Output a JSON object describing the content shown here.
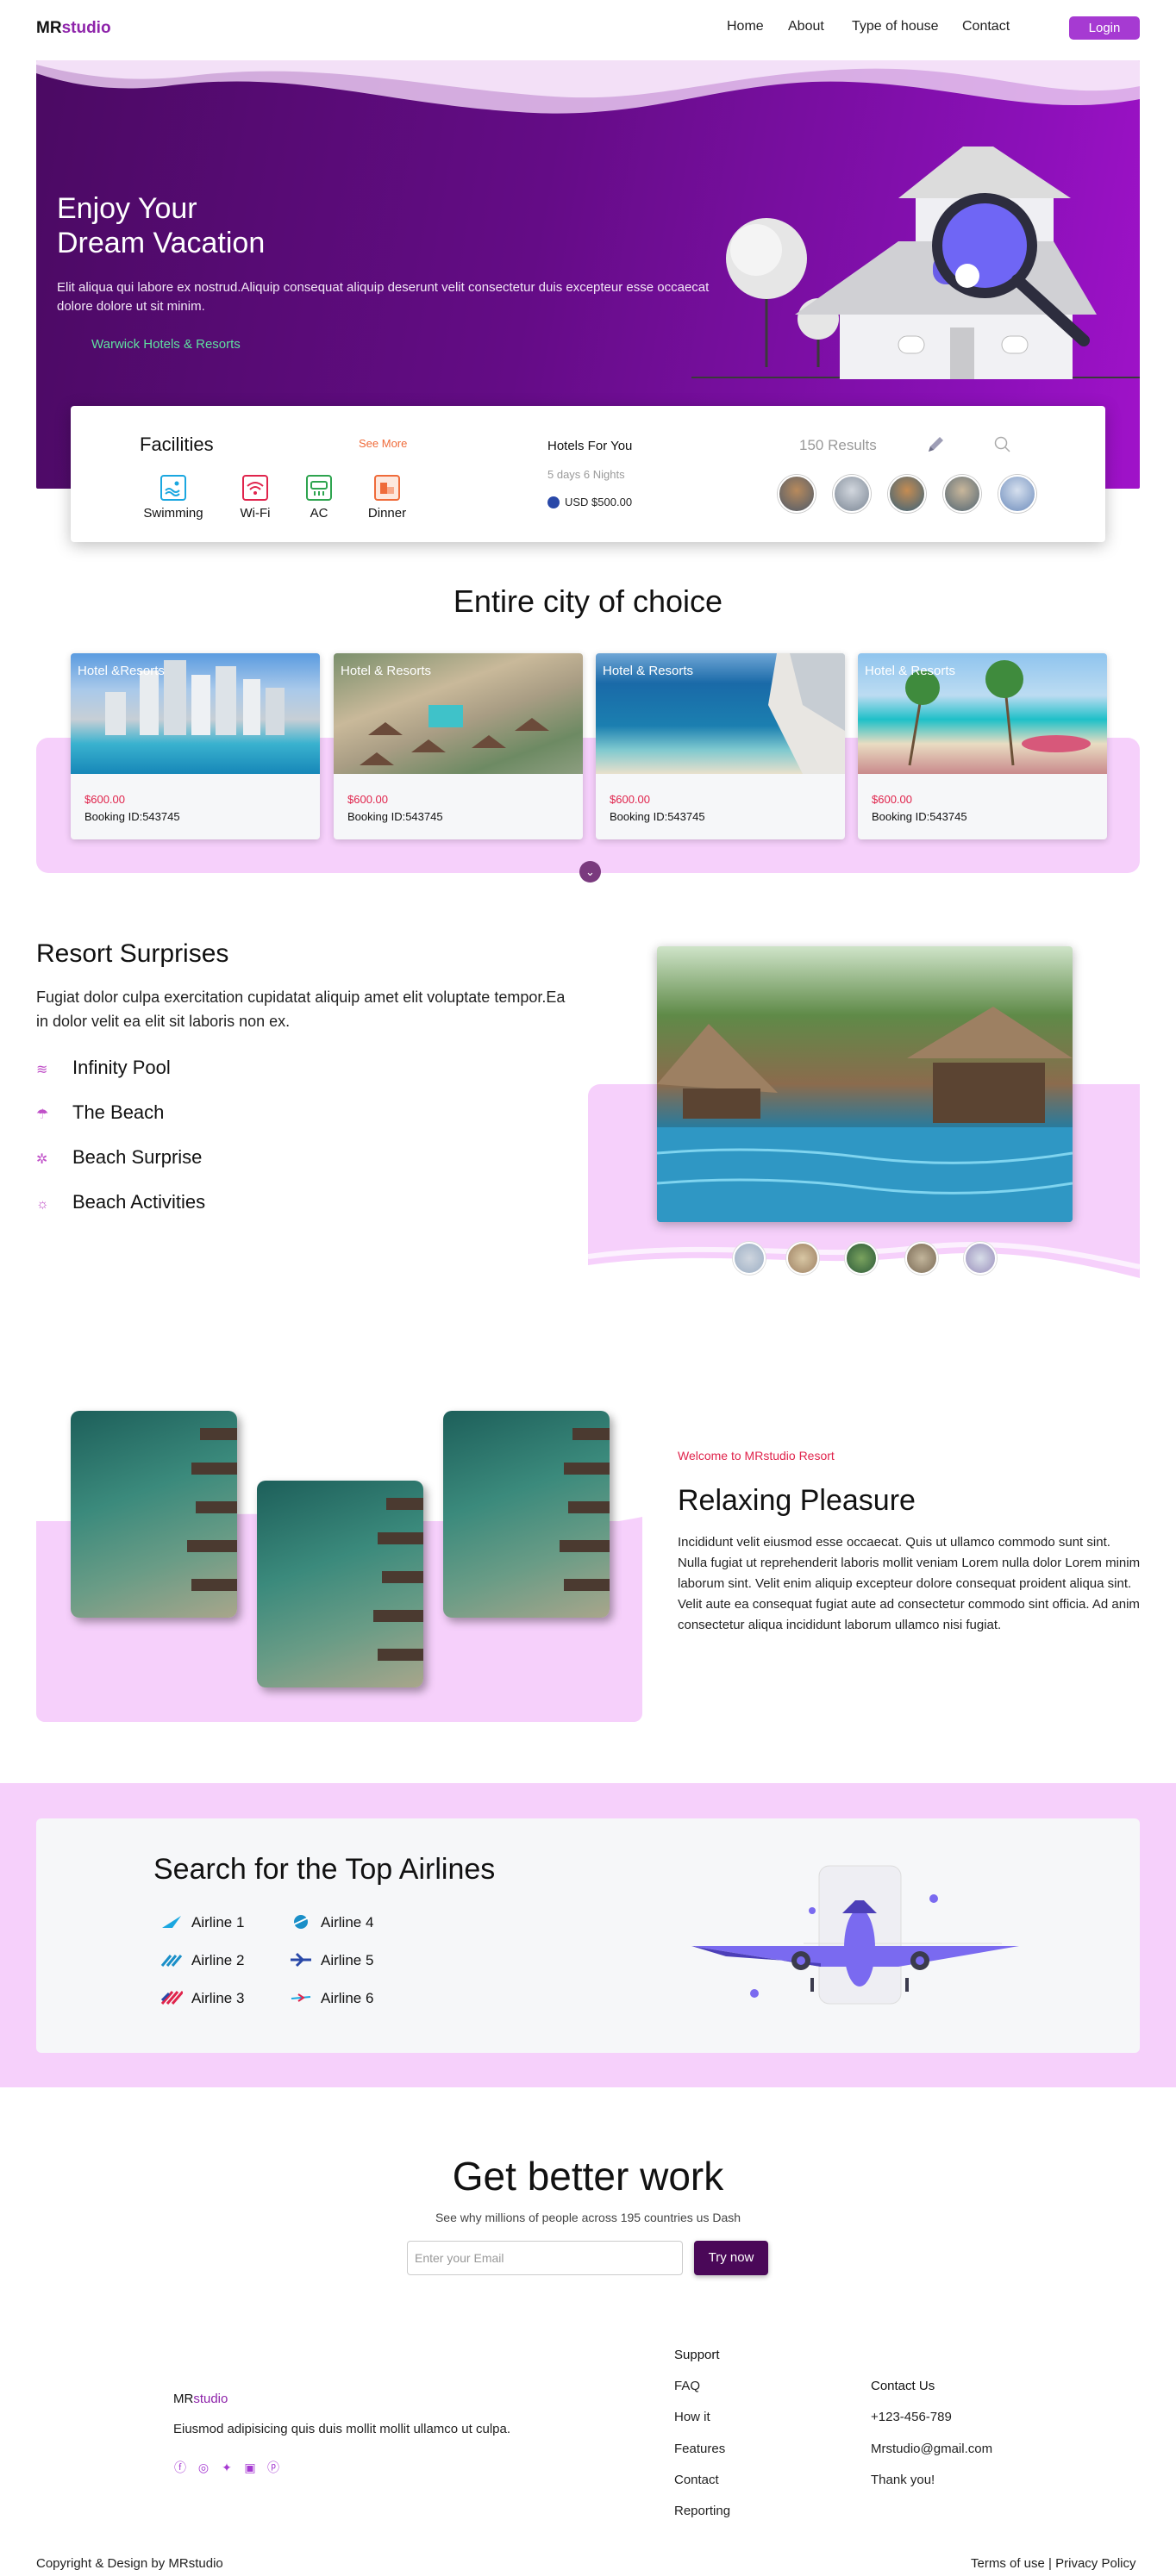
{
  "nav": {
    "logo_main": "MR",
    "logo_accent": "studio",
    "items": [
      "Home",
      "About",
      "Type of house",
      "Contact"
    ],
    "login_label": "Login"
  },
  "hero": {
    "title_line1": "Enjoy Your",
    "title_line2": "Dream Vacation",
    "description": "Elit aliqua qui labore ex nostrud.Aliquip consequat aliquip deserunt velit consectetur duis excepteur esse occaecat dolore dolore ut sit minim.",
    "link": "Warwick Hotels & Resorts"
  },
  "facilities": {
    "title": "Facilities",
    "see_more": "See More",
    "items": [
      {
        "label": "Swimming",
        "icon": "swimming-icon",
        "color": "#1aa7e0"
      },
      {
        "label": "Wi-Fi",
        "icon": "wifi-icon",
        "color": "#e0244c"
      },
      {
        "label": "AC",
        "icon": "ac-icon",
        "color": "#2ea44f"
      },
      {
        "label": "Dinner",
        "icon": "dinner-icon",
        "color": "#ef6b3a"
      }
    ],
    "hotels_title": "Hotels For You",
    "hotels_sub": "5 days 6 Nights",
    "hotels_price": "USD $500.00",
    "results": "150 Results",
    "edit_icon": "pencil-icon",
    "search_icon": "search-icon"
  },
  "city": {
    "title": "Entire city of choice",
    "cards": [
      {
        "label": "Hotel &Resorts",
        "price": "$600.00",
        "booking": "Booking ID:543745"
      },
      {
        "label": "Hotel & Resorts",
        "price": "$600.00",
        "booking": "Booking ID:543745"
      },
      {
        "label": "Hotel & Resorts",
        "price": "$600.00",
        "booking": "Booking ID:543745"
      },
      {
        "label": "Hotel & Resorts",
        "price": "$600.00",
        "booking": "Booking ID:543745"
      }
    ],
    "more_icon": "chevron-down-icon"
  },
  "resort": {
    "title": "Resort Surprises",
    "description": "Fugiat dolor culpa exercitation cupidatat aliquip amet elit voluptate tempor.Ea in dolor velit ea elit sit laboris non ex.",
    "items": [
      {
        "label": "Infinity Pool",
        "icon": "pool-icon"
      },
      {
        "label": "The Beach",
        "icon": "beach-umbrella-icon"
      },
      {
        "label": "Beach Surprise",
        "icon": "island-icon"
      },
      {
        "label": "Beach Activities",
        "icon": "sun-icon"
      }
    ]
  },
  "relax": {
    "welcome": "Welcome to MRstudio Resort",
    "title": "Relaxing Pleasure",
    "description": "Incididunt velit eiusmod esse occaecat. Quis ut ullamco commodo sunt sint. Nulla fugiat ut reprehenderit laboris mollit veniam Lorem nulla dolor Lorem minim laborum sint. Velit enim aliquip excepteur dolore consequat proident aliqua sint. Velit aute ea consequat fugiat aute ad consectetur commodo sint officia. Ad anim consectetur aliqua incididunt laborum ullamco nisi fugiat."
  },
  "airlines": {
    "title": "Search for the Top Airlines",
    "items": [
      "Airline 1",
      "Airline 2",
      "Airline 3",
      "Airline 4",
      "Airline 5",
      "Airline 6"
    ]
  },
  "cta": {
    "title": "Get better work",
    "subtitle": "See why millions of people across 195 countries us Dash",
    "email_placeholder": "Enter your Email",
    "button": "Try now"
  },
  "footer": {
    "logo_main": "MR",
    "logo_accent": "studio",
    "description": "Eiusmod adipisicing quis duis mollit mollit ullamco ut culpa.",
    "social": [
      "facebook-icon",
      "instagram-icon",
      "twitter-icon",
      "linkedin-icon",
      "pinterest-icon"
    ],
    "support_title": "Support",
    "support_links": [
      "FAQ",
      "How it",
      "Features",
      "Contact",
      "Reporting"
    ],
    "contact_title": "Contact Us",
    "contact_items": [
      "+123-456-789",
      "Mrstudio@gmail.com",
      "Thank you!"
    ],
    "copyright": "Copyright & Design by MRstudio",
    "terms": "Terms of use",
    "separator": "|",
    "privacy": "Privacy Policy"
  },
  "colors": {
    "accent": "#a63ad2",
    "hero_dark": "#4b0a63",
    "hero_light": "#a012c9",
    "pink_band": "#f6d0fb",
    "price_red": "#e0244c"
  }
}
